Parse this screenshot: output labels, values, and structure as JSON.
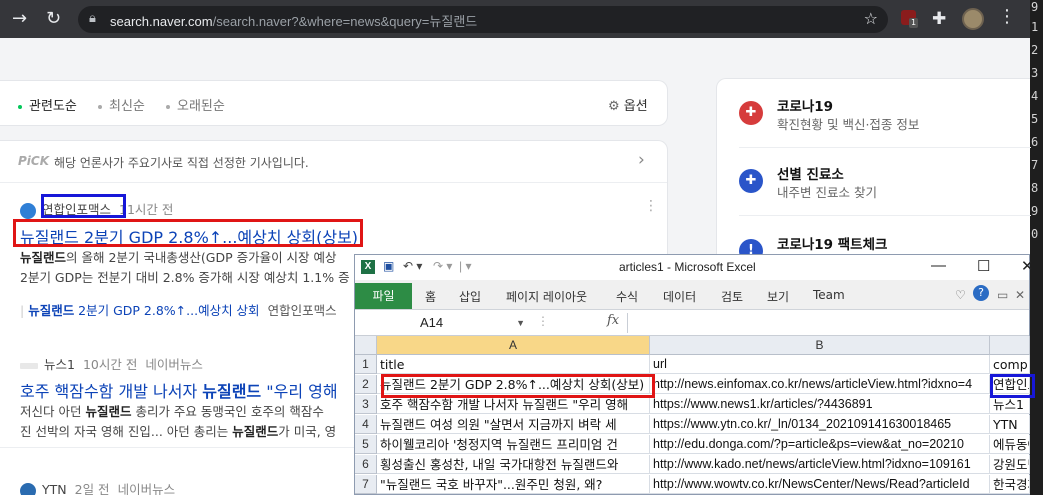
{
  "browser": {
    "url_host": "search.naver.com",
    "url_path": "/search.naver?&where=news&query=뉴질랜드",
    "ext_badge": "1"
  },
  "editor_strip": [
    "9",
    "1",
    "2",
    "3",
    "4",
    "5",
    "6",
    "7",
    "8",
    "9",
    "0"
  ],
  "sort": {
    "options": [
      "관련도순",
      "최신순",
      "오래된순"
    ],
    "settings_label": "옵션"
  },
  "pick": {
    "tag": "PiCK",
    "text": "해당 언론사가 주요기사로 직접 선정한 기사입니다."
  },
  "news": [
    {
      "press": "연합인포맥스",
      "time": "11시간 전",
      "title": "뉴질랜드 2분기 GDP 2.8%↑...예상치 상회(상보)",
      "desc1_kw": "뉴질랜드",
      "desc1": "의 올해 2분기 국내총생산(GDP 증가율이 시장 예상",
      "desc2": "2분기 GDP는 전분기 대비 2.8% 증가해 시장 예상치 1.1% 증",
      "rel_kw": "뉴질랜드",
      "rel": " 2분기 GDP 2.8%↑...예상치 상회",
      "rel_src": "연합인포맥스"
    },
    {
      "press": "뉴스1",
      "time": "10시간 전",
      "portal": "네이버뉴스",
      "title_pre": "호주 핵잠수함 개발 나서자 ",
      "title_kw": "뉴질랜드",
      "title_post": " \"우리 영해",
      "desc1": "저신다 아던 ",
      "desc1_kw": "뉴질랜드",
      "desc1_post": " 총리가 주요 동맹국인 호주의 핵잠수",
      "desc2": "진 선박의 자국 영해 진입... 아던 총리는 ",
      "desc2_kw": "뉴질랜드",
      "desc2_post": "가 미국, 영"
    },
    {
      "press": "YTN",
      "time": "2일 전",
      "portal": "네이버뉴스"
    }
  ],
  "side": [
    {
      "title": "코로나19",
      "sub": "확진현황 및 백신·접종 정보"
    },
    {
      "title": "선별 진료소",
      "sub": "내주변 진료소 찾기"
    },
    {
      "title": "코로나19 팩트체크",
      "sub": ""
    }
  ],
  "excel": {
    "window_title": "articles1  -  Microsoft Excel",
    "tabs": [
      "파일",
      "홈",
      "삽입",
      "페이지 레이아웃",
      "수식",
      "데이터",
      "검토",
      "보기",
      "Team"
    ],
    "namebox": "A14",
    "fx": "fx",
    "columns": [
      "A",
      "B"
    ],
    "rows": [
      {
        "n": "1",
        "title": "title",
        "url": "url",
        "comp": "comp"
      },
      {
        "n": "2",
        "title": "뉴질랜드 2분기 GDP 2.8%↑...예상치 상회(상보)",
        "url": "http://news.einfomax.co.kr/news/articleView.html?idxno=4",
        "comp": "연합인포"
      },
      {
        "n": "3",
        "title": "호주 핵잠수함 개발 나서자 뉴질랜드 \"우리 영해",
        "url": "https://www.news1.kr/articles/?4436891",
        "comp": "뉴스1"
      },
      {
        "n": "4",
        "title": "뉴질랜드 여성 의원 \"살면서 지금까지 벼락 세",
        "url": "https://www.ytn.co.kr/_ln/0134_202109141630018465",
        "comp": "YTN"
      },
      {
        "n": "5",
        "title": "하이웰코리아 '청정지역 뉴질랜드 프리미엄 건",
        "url": "http://edu.donga.com/?p=article&ps=view&at_no=20210",
        "comp": "에듀동아"
      },
      {
        "n": "6",
        "title": "횡성출신 홍성찬, 내일 국가대항전 뉴질랜드와",
        "url": "http://www.kado.net/news/articleView.html?idxno=109161",
        "comp": "강원도민"
      },
      {
        "n": "7",
        "title": "\"뉴질랜드 국호 바꾸자\"...원주민 청원, 왜?",
        "url": "http://www.wowtv.co.kr/NewsCenter/News/Read?articleId",
        "comp": "한국경제"
      }
    ]
  }
}
